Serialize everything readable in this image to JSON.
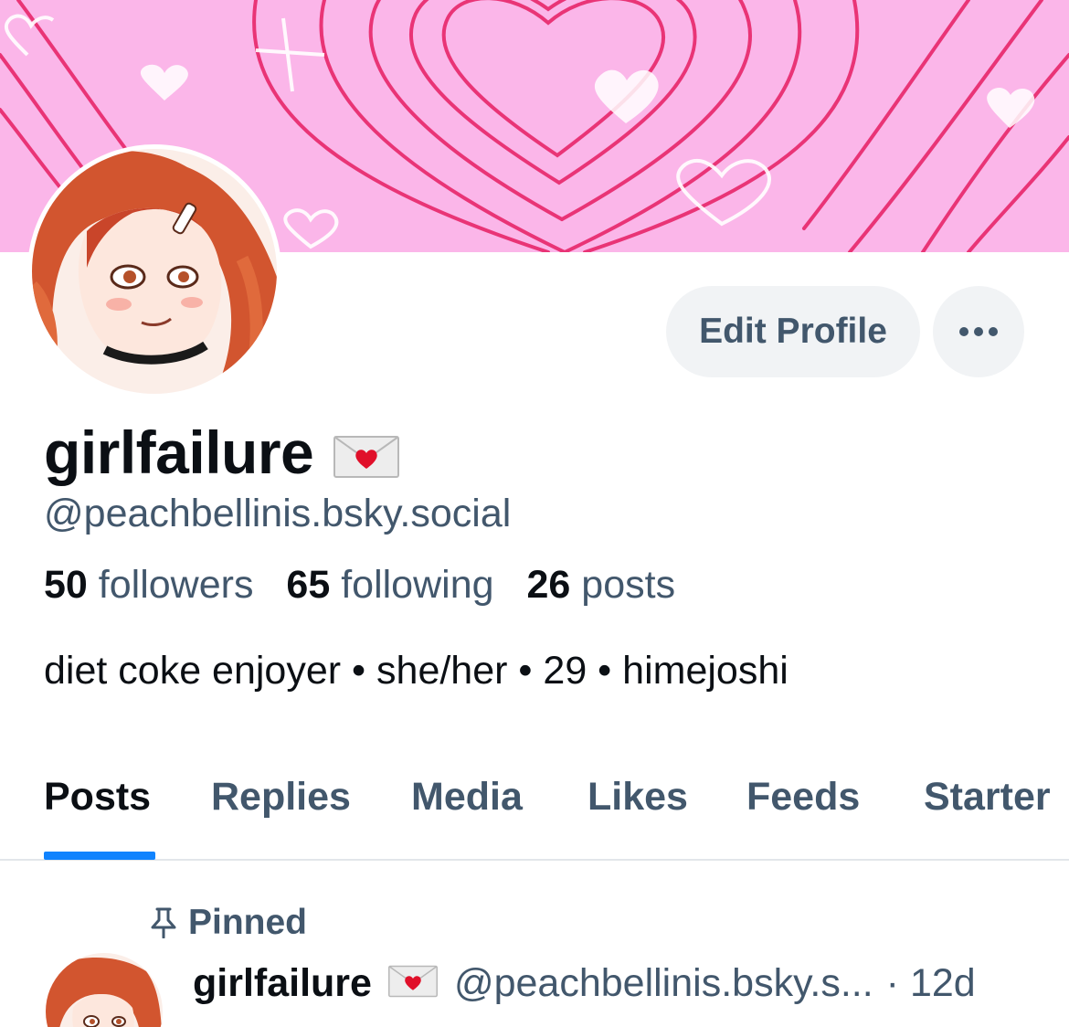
{
  "profile": {
    "display_name": "girlfailure",
    "name_emoji": "love-letter-emoji",
    "handle": "@peachbellinis.bsky.social",
    "bio": "diet coke enjoyer • she/her • 29 • himejoshi"
  },
  "stats": {
    "followers_count": "50",
    "followers_label": "followers",
    "following_count": "65",
    "following_label": "following",
    "posts_count": "26",
    "posts_label": "posts"
  },
  "actions": {
    "edit_profile": "Edit Profile",
    "more": "more-icon"
  },
  "tabs": [
    {
      "label": "Posts",
      "active": true
    },
    {
      "label": "Replies",
      "active": false
    },
    {
      "label": "Media",
      "active": false
    },
    {
      "label": "Likes",
      "active": false
    },
    {
      "label": "Feeds",
      "active": false
    },
    {
      "label": "Starter",
      "active": false
    }
  ],
  "pinned_post": {
    "pinned_label": "Pinned",
    "author_name": "girlfailure",
    "author_handle": "@peachbellinis.bsky.s...",
    "separator": "·",
    "time": "12d"
  },
  "colors": {
    "banner_pink": "#fbb6e9",
    "heart_red": "#e8266a",
    "accent_blue": "#1083fe",
    "muted_text": "#42576c"
  }
}
